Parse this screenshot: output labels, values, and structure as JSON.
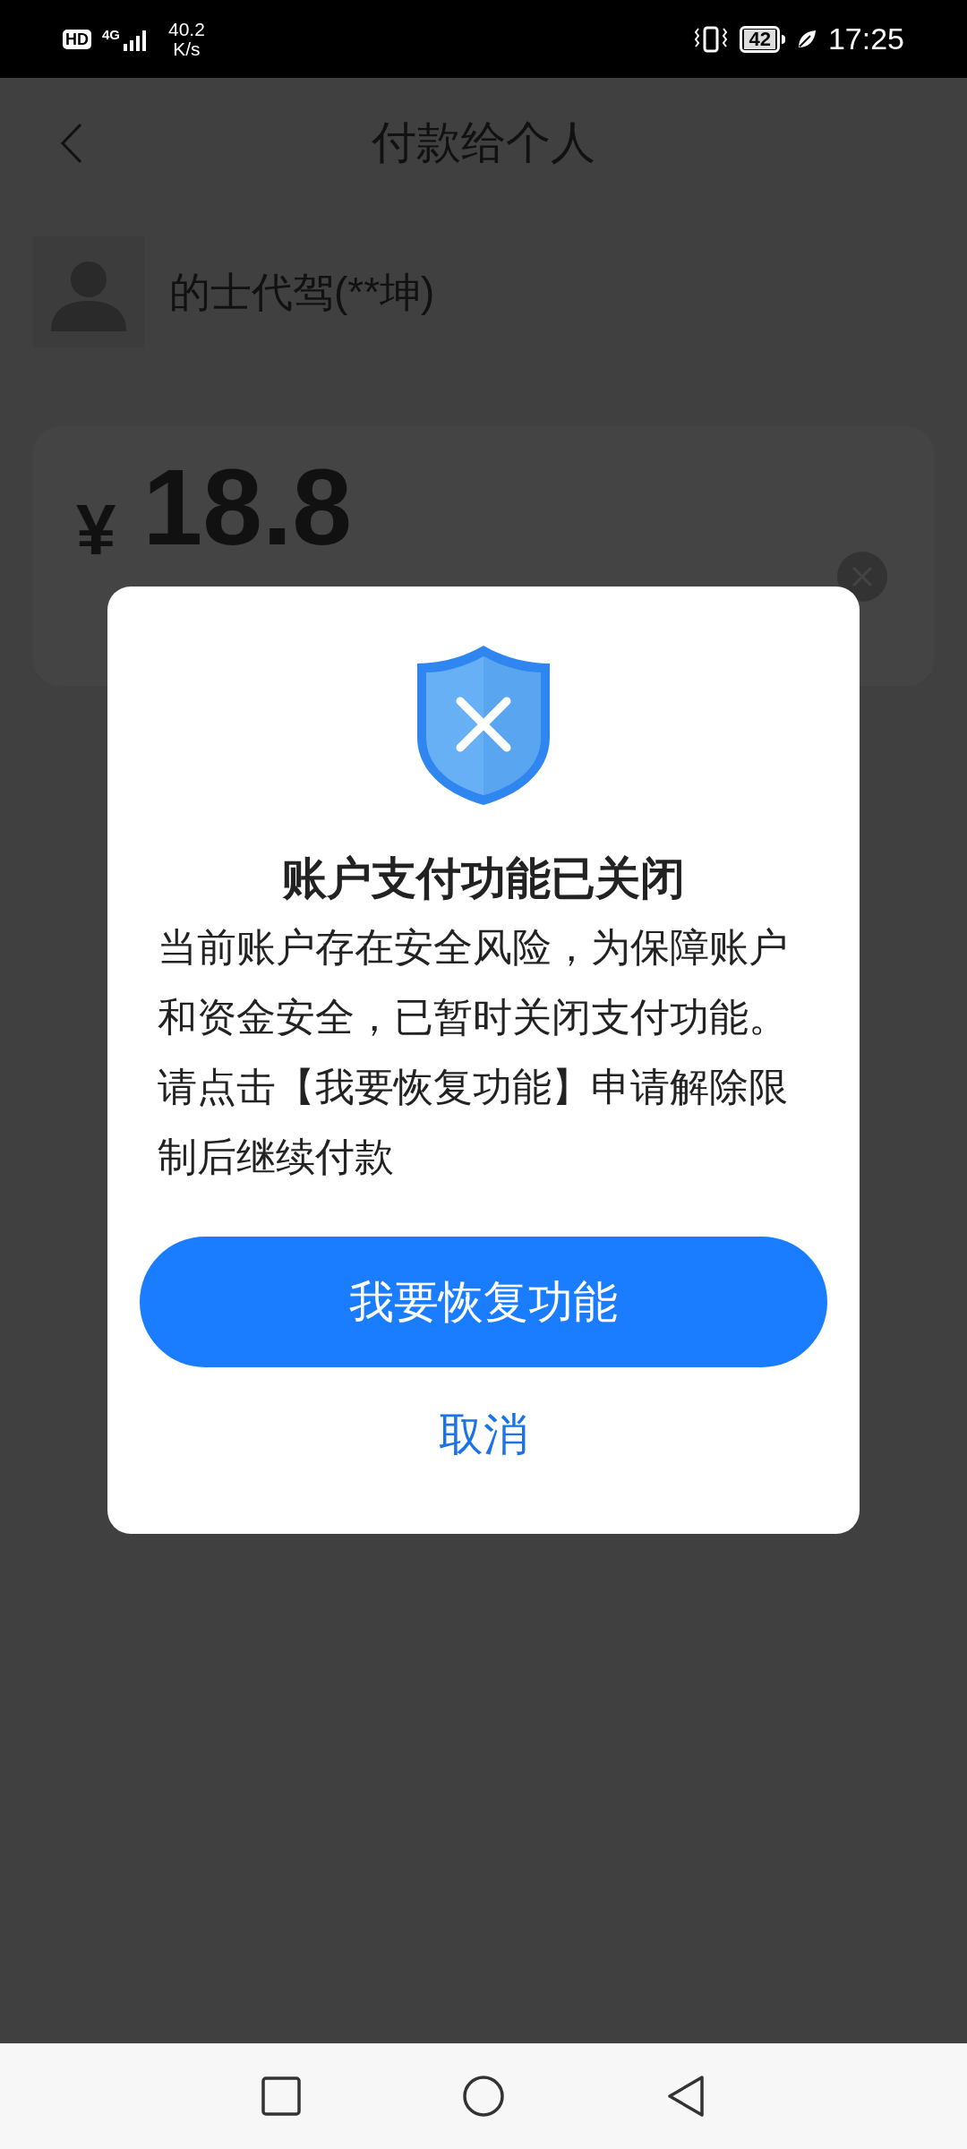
{
  "status_bar": {
    "hd": "HD",
    "network": "4G",
    "speed": "40.2",
    "speed_unit": "K/s",
    "battery": "42",
    "time": "17:25"
  },
  "header": {
    "title": "付款给个人"
  },
  "payee": {
    "name": "的士代驾(**坤)"
  },
  "amount": {
    "currency": "¥",
    "value": "18.8"
  },
  "dialog": {
    "title": "账户支付功能已关闭",
    "message": "当前账户存在安全风险，为保障账户和资金安全，已暂时关闭支付功能。请点击【我要恢复功能】申请解除限制后继续付款",
    "primary_button": "我要恢复功能",
    "cancel_button": "取消"
  }
}
